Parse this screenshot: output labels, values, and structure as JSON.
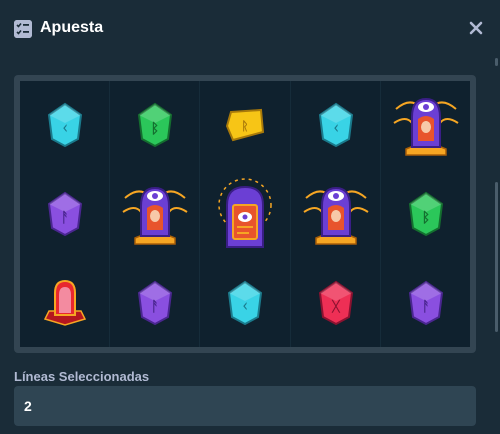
{
  "header": {
    "title": "Apuesta",
    "icon": "bet-slip-icon",
    "close_icon": "close-icon"
  },
  "reels": [
    [
      "cyan-rune-gem",
      "violet-rune-gem",
      "red-mage-card"
    ],
    [
      "green-rune-gem",
      "oracle-eye-priestess",
      "violet-rune-gem"
    ],
    [
      "yellow-rune-gem",
      "arcane-portal-door",
      "cyan-rune-gem"
    ],
    [
      "cyan-rune-gem",
      "oracle-eye-priestess",
      "red-rune-gem"
    ],
    [
      "oracle-eye-priestess",
      "green-rune-gem",
      "violet-rune-gem"
    ]
  ],
  "lines": {
    "label": "Líneas Seleccionadas",
    "value": "2"
  },
  "colors": {
    "background": "#1a2c38",
    "reel_background": "#0f212e",
    "frame": "#334552",
    "input": "#2f4553",
    "label": "#b1bad3"
  }
}
